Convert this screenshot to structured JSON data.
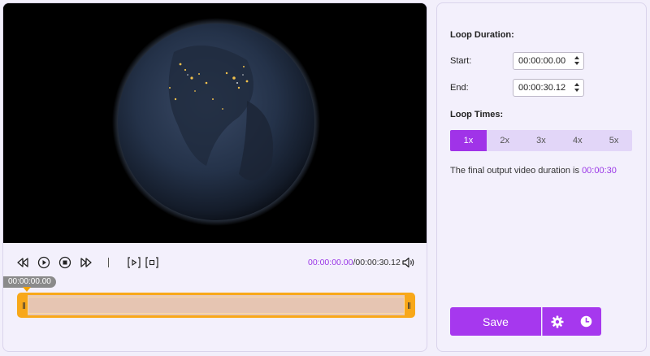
{
  "player": {
    "current_time": "00:00:00.00",
    "total_time": "/00:00:30.12",
    "playhead_label": "00:00:00.00"
  },
  "controls": {
    "icons": [
      "rewind-icon",
      "play-icon",
      "stop-icon",
      "fast-forward-icon",
      "set-start-icon",
      "set-end-icon",
      "volume-icon"
    ]
  },
  "loop": {
    "duration_title": "Loop Duration:",
    "start_label": "Start:",
    "start_value": "00:00:00.00",
    "end_label": "End:",
    "end_value": "00:00:30.12",
    "times_title": "Loop Times:",
    "times_options": [
      "1x",
      "2x",
      "3x",
      "4x",
      "5x"
    ],
    "times_selected": "1x",
    "output_text": "The final output video duration is",
    "output_value": "00:00:30"
  },
  "actions": {
    "save_label": "Save",
    "settings_icon": "gear-icon",
    "schedule_icon": "clock-icon"
  },
  "colors": {
    "accent": "#a638ee",
    "time_highlight": "#9a37e6",
    "trim_border": "#f8a81a"
  }
}
